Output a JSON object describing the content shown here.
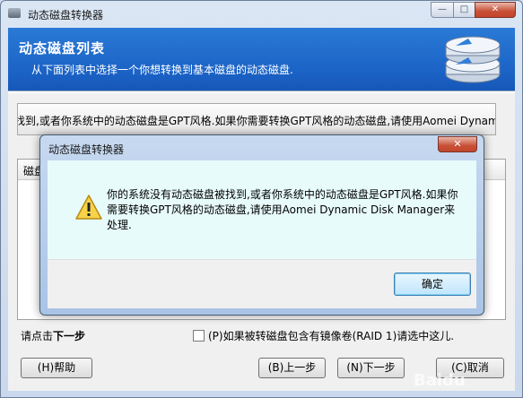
{
  "window": {
    "title": "动态磁盘转换器",
    "controls": {
      "minimize": "—",
      "maximize": "□",
      "close": "✕"
    }
  },
  "header": {
    "title": "动态磁盘列表",
    "subtitle": "从下面列表中选择一个你想转换到基本磁盘的动态磁盘."
  },
  "message_box": {
    "text": "找到,或者你系统中的动态磁盘是GPT风格.如果你需要转换GPT风格的动态磁盘,请使用Aomei Dynamic"
  },
  "list": {
    "header_label": "磁盘"
  },
  "footer": {
    "prompt_prefix": "请点击",
    "prompt_bold": "下一步",
    "raid_checkbox_label": "(P)如果被转磁盘包含有镜像卷(RAID 1)请选中这儿."
  },
  "buttons": {
    "help": "(H)帮助",
    "back": "(B)上一步",
    "next": "(N)下一步",
    "cancel": "(C)取消"
  },
  "dialog": {
    "title": "动态磁盘转换器",
    "message": "你的系统没有动态磁盘被找到,或者你系统中的动态磁盘是GPT风格.如果你需要转换GPT风格的动态磁盘,请使用Aomei Dynamic Disk Manager来处理.",
    "ok": "确定",
    "close": "✕"
  },
  "watermark": "Baidu",
  "colors": {
    "header_blue": "#1b63c6",
    "dialog_body": "#e8fbfb",
    "close_red": "#c74f36"
  }
}
